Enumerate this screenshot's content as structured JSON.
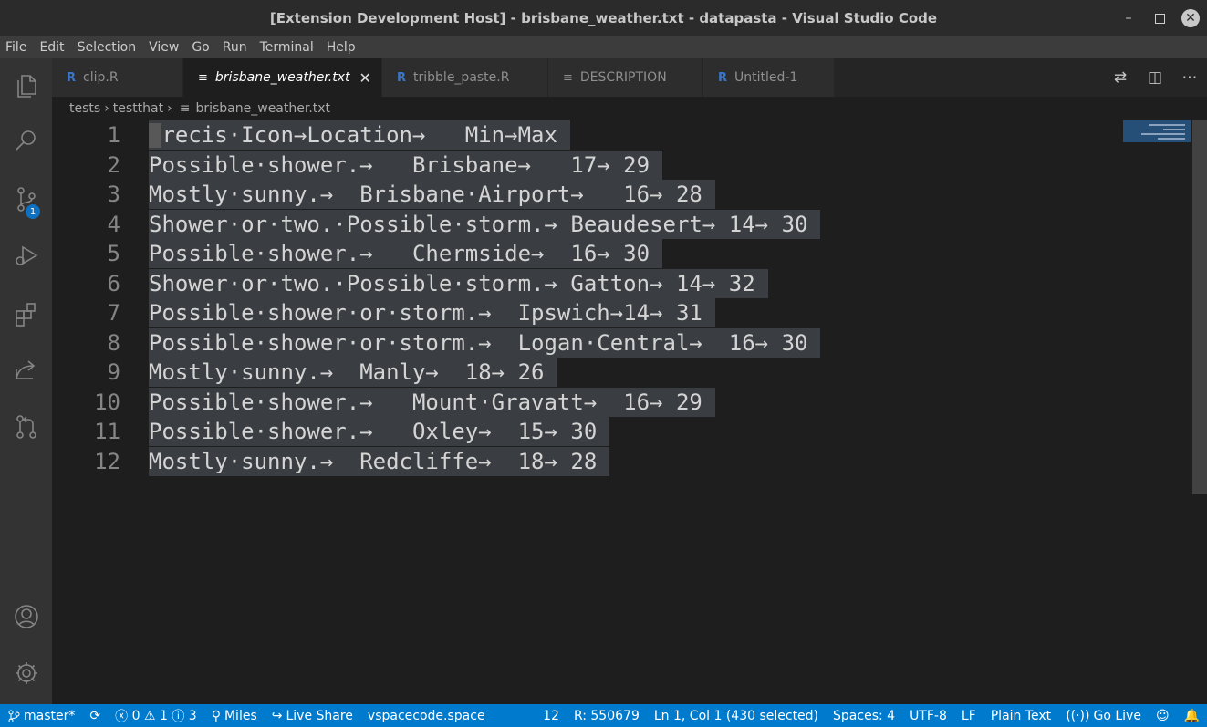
{
  "window": {
    "title": "[Extension Development Host] - brisbane_weather.txt - datapasta - Visual Studio Code"
  },
  "menu": [
    "File",
    "Edit",
    "Selection",
    "View",
    "Go",
    "Run",
    "Terminal",
    "Help"
  ],
  "activity": {
    "scm_badge": "1"
  },
  "tabs": [
    {
      "label": "clip.R",
      "icon": "r-file-icon",
      "glyph": "R"
    },
    {
      "label": "brisbane_weather.txt",
      "icon": "text-file-icon",
      "glyph": "≡",
      "close": "✕"
    },
    {
      "label": "tribble_paste.R",
      "icon": "r-file-icon",
      "glyph": "R"
    },
    {
      "label": "DESCRIPTION",
      "icon": "text-file-icon",
      "glyph": "≡"
    },
    {
      "label": "Untitled-1",
      "icon": "r-file-icon",
      "glyph": "R"
    }
  ],
  "breadcrumb": {
    "part1": "tests",
    "part2": "testthat",
    "file_glyph": "≡",
    "file": "brisbane_weather.txt",
    "sep": "›"
  },
  "lines": [
    {
      "n": "1",
      "text": "Precis·Icon→Location→   Min→Max"
    },
    {
      "n": "2",
      "text": "Possible·shower.→   Brisbane→   17→ 29"
    },
    {
      "n": "3",
      "text": "Mostly·sunny.→  Brisbane·Airport→   16→ 28"
    },
    {
      "n": "4",
      "text": "Shower·or·two.·Possible·storm.→ Beaudesert→ 14→ 30"
    },
    {
      "n": "5",
      "text": "Possible·shower.→   Chermside→  16→ 30"
    },
    {
      "n": "6",
      "text": "Shower·or·two.·Possible·storm.→ Gatton→ 14→ 32"
    },
    {
      "n": "7",
      "text": "Possible·shower·or·storm.→  Ipswich→14→ 31"
    },
    {
      "n": "8",
      "text": "Possible·shower·or·storm.→  Logan·Central→  16→ 30"
    },
    {
      "n": "9",
      "text": "Mostly·sunny.→  Manly→  18→ 26"
    },
    {
      "n": "10",
      "text": "Possible·shower.→   Mount·Gravatt→  16→ 29"
    },
    {
      "n": "11",
      "text": "Possible·shower.→   Oxley→  15→ 30"
    },
    {
      "n": "12",
      "text": "Mostly·sunny.→  Redcliffe→  18→ 28"
    }
  ],
  "status": {
    "branch": "master*",
    "errors": "0",
    "warnings": "1",
    "info": "3",
    "user": "Miles",
    "liveshare": "Live Share",
    "space": "vspacecode.space",
    "count": "12",
    "rvalue": "R: 550679",
    "position": "Ln 1, Col 1 (430 selected)",
    "spaces": "Spaces: 4",
    "encoding": "UTF-8",
    "eol": "LF",
    "language": "Plain Text",
    "golive": "Go Live"
  }
}
